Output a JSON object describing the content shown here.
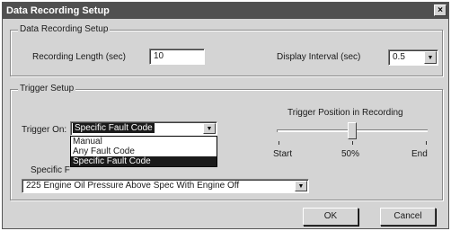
{
  "window": {
    "title": "Data Recording Setup",
    "close_glyph": "×"
  },
  "data_recording_group": {
    "legend": "Data Recording Setup",
    "recording_length_label": "Recording Length (sec)",
    "recording_length_value": "10",
    "display_interval_label": "Display Interval (sec)",
    "display_interval_value": "0.5"
  },
  "trigger_group": {
    "legend": "Trigger Setup",
    "trigger_on_label": "Trigger On:",
    "trigger_on_value": "Specific Fault Code",
    "trigger_on_options": [
      "Manual",
      "Any Fault Code",
      "Specific Fault Code"
    ],
    "trigger_on_selected_index": 2,
    "specific_fault_label": "Specific F",
    "specific_fault_value": "225 Engine Oil Pressure Above Spec With Engine Off",
    "trigger_position_label": "Trigger Position in Recording",
    "slider_value_fraction": 0.5,
    "slider_start_label": "Start",
    "slider_mid_label": "50%",
    "slider_end_label": "End"
  },
  "buttons": {
    "ok": "OK",
    "cancel": "Cancel"
  },
  "dropdown_arrow_glyph": "▼"
}
